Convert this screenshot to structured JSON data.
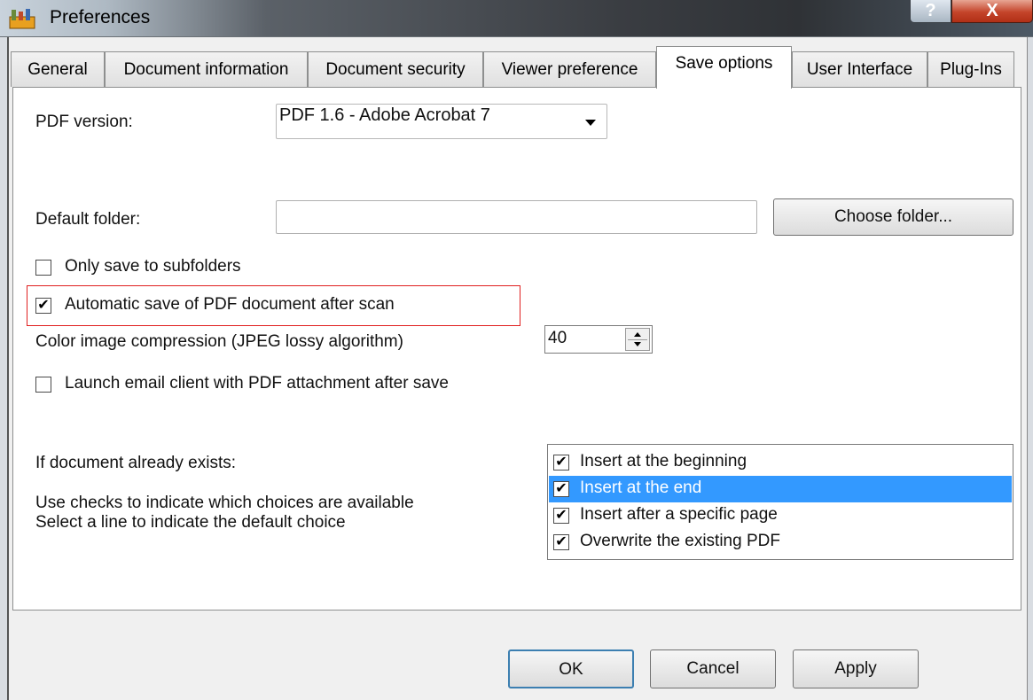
{
  "window": {
    "title": "Preferences",
    "help_glyph": "?",
    "close_glyph": "X",
    "app_icon": "app-icon"
  },
  "tabs": [
    {
      "label": "General",
      "active": false
    },
    {
      "label": "Document information",
      "active": false
    },
    {
      "label": "Document security",
      "active": false
    },
    {
      "label": "Viewer preference",
      "active": false
    },
    {
      "label": "Save options",
      "active": true
    },
    {
      "label": "User Interface",
      "active": false
    },
    {
      "label": "Plug-Ins",
      "active": false
    }
  ],
  "pdf_version": {
    "label": "PDF version:",
    "value": "PDF 1.6 - Adobe Acrobat 7"
  },
  "default_folder": {
    "label": "Default folder:",
    "value": "",
    "choose_button": "Choose folder..."
  },
  "options": {
    "only_subfolders": {
      "label": "Only save to subfolders",
      "checked": false
    },
    "auto_save": {
      "label": "Automatic save of PDF document after scan",
      "checked": true
    },
    "launch_email": {
      "label": "Launch email client with PDF attachment after save",
      "checked": false
    }
  },
  "compression": {
    "label": "Color image compression (JPEG lossy algorithm)",
    "value": "40"
  },
  "exists": {
    "label": "If document already exists:",
    "hint_line1": "Use checks to indicate which choices are available",
    "hint_line2": "Select a line to indicate the default choice",
    "items": [
      {
        "label": "Insert at the beginning",
        "checked": true,
        "selected": false
      },
      {
        "label": "Insert at the end",
        "checked": true,
        "selected": true
      },
      {
        "label": "Insert after a specific page",
        "checked": true,
        "selected": false
      },
      {
        "label": "Overwrite the existing PDF",
        "checked": true,
        "selected": false
      }
    ]
  },
  "buttons": {
    "ok": "OK",
    "cancel": "Cancel",
    "apply": "Apply"
  },
  "check_glyph": "✔",
  "colors": {
    "selection": "#3399ff",
    "highlight_border": "#e02020"
  }
}
